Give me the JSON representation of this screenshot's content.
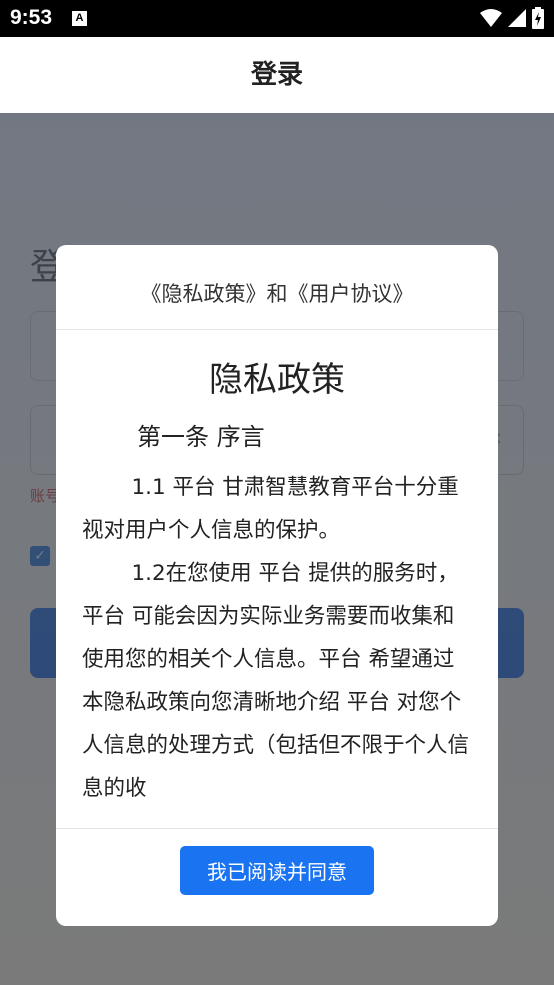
{
  "status_bar": {
    "time": "9:53",
    "notification_icon": "A"
  },
  "header": {
    "title": "登录"
  },
  "login": {
    "title_visible": "登",
    "hint_visible": "账号"
  },
  "dialog": {
    "title": "《隐私政策》和《用户协议》",
    "heading": "隐私政策",
    "section": "第一条 序言",
    "paragraphs": [
      "1.1 平台 甘肃智慧教育平台十分重视对用户个人信息的保护。",
      "1.2在您使用 平台 提供的服务时， 平台 可能会因为实际业务需要而收集和使用您的相关个人信息。平台 希望通过本隐私政策向您清晰地介绍 平台 对您个人信息的处理方式（包括但不限于个人信息的收"
    ],
    "agree_label": "我已阅读并同意"
  },
  "colors": {
    "primary": "#1a73f0",
    "error": "#d9312b"
  }
}
